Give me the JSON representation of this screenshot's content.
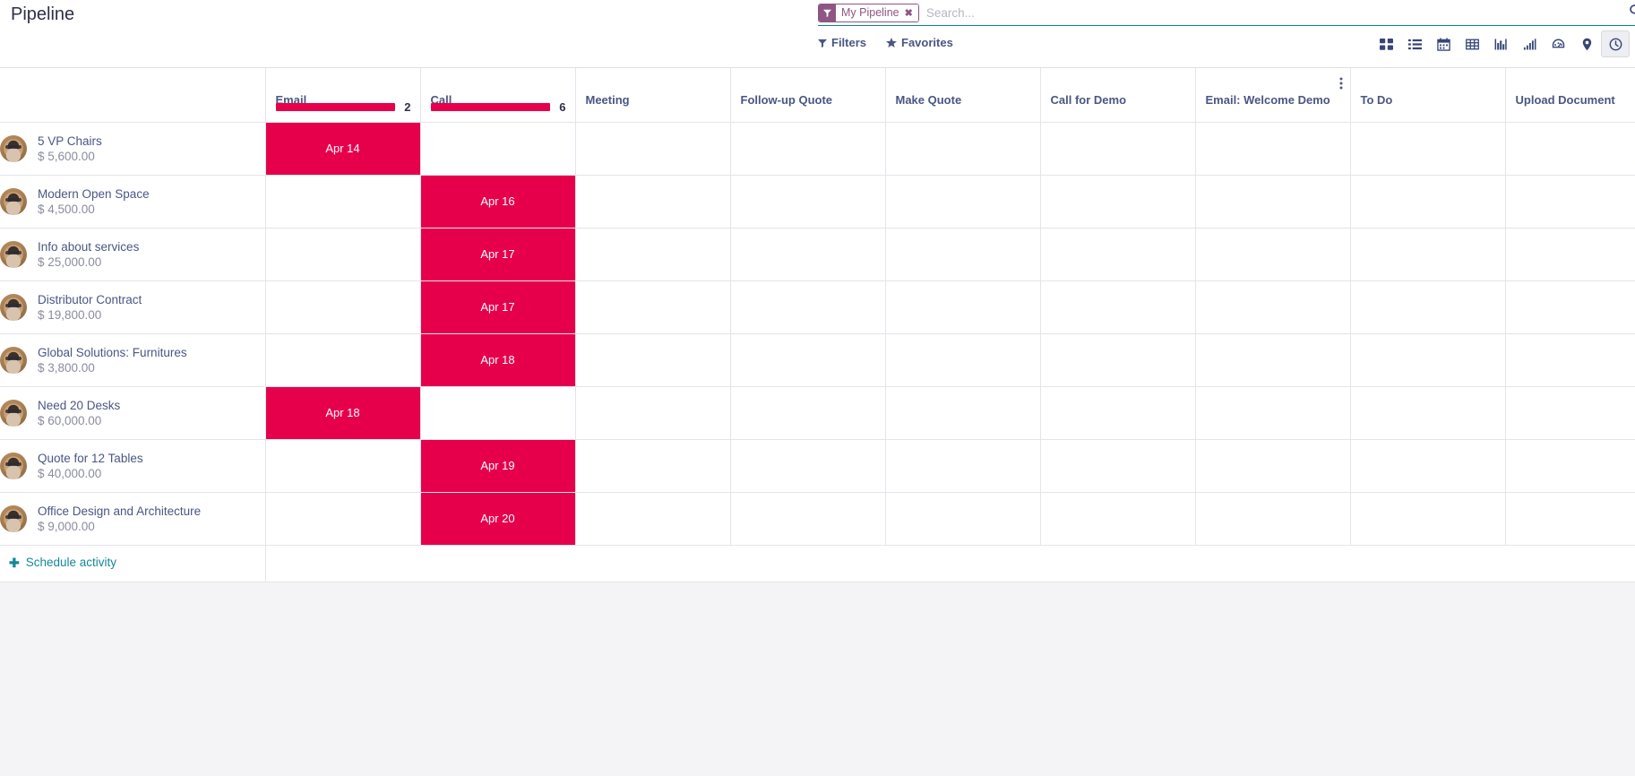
{
  "breadcrumb": {
    "title": "Pipeline"
  },
  "search": {
    "facet": {
      "icon": "filter-icon",
      "label": "My Pipeline",
      "close": "✖"
    },
    "placeholder": "Search...",
    "value": "",
    "toggle_icon": "search-icon"
  },
  "toolbar": {
    "filters_label": "Filters",
    "favorites_label": "Favorites",
    "views": [
      {
        "name": "kanban",
        "title": "Kanban",
        "active": false
      },
      {
        "name": "list",
        "title": "List",
        "active": false
      },
      {
        "name": "calendar",
        "title": "Calendar",
        "active": false
      },
      {
        "name": "pivot",
        "title": "Pivot",
        "active": false
      },
      {
        "name": "graph",
        "title": "Graph",
        "active": false
      },
      {
        "name": "cohort",
        "title": "Cohort",
        "active": false
      },
      {
        "name": "dashboard",
        "title": "Dashboard",
        "active": false
      },
      {
        "name": "map",
        "title": "Map",
        "active": false
      },
      {
        "name": "activity",
        "title": "Activity",
        "active": true
      }
    ]
  },
  "table": {
    "record_column_header": "",
    "columns": [
      {
        "label": "Email",
        "count": "2",
        "progress": 100,
        "has_options": false
      },
      {
        "label": "Call",
        "count": "6",
        "progress": 100,
        "has_options": false
      },
      {
        "label": "Meeting",
        "count": "",
        "progress": 0,
        "has_options": false
      },
      {
        "label": "Follow-up Quote",
        "count": "",
        "progress": 0,
        "has_options": false
      },
      {
        "label": "Make Quote",
        "count": "",
        "progress": 0,
        "has_options": false
      },
      {
        "label": "Call for Demo",
        "count": "",
        "progress": 0,
        "has_options": false
      },
      {
        "label": "Email: Welcome Demo",
        "count": "",
        "progress": 0,
        "has_options": true
      },
      {
        "label": "To Do",
        "count": "",
        "progress": 0,
        "has_options": false
      },
      {
        "label": "Upload Document",
        "count": "",
        "progress": 0,
        "has_options": false
      }
    ],
    "rows": [
      {
        "title": "5 VP Chairs",
        "amount": "$ 5,600.00",
        "cells": [
          "Apr 14",
          "",
          "",
          "",
          "",
          "",
          "",
          "",
          ""
        ]
      },
      {
        "title": "Modern Open Space",
        "amount": "$ 4,500.00",
        "cells": [
          "",
          "Apr 16",
          "",
          "",
          "",
          "",
          "",
          "",
          ""
        ]
      },
      {
        "title": "Info about services",
        "amount": "$ 25,000.00",
        "cells": [
          "",
          "Apr 17",
          "",
          "",
          "",
          "",
          "",
          "",
          ""
        ]
      },
      {
        "title": "Distributor Contract",
        "amount": "$ 19,800.00",
        "cells": [
          "",
          "Apr 17",
          "",
          "",
          "",
          "",
          "",
          "",
          ""
        ]
      },
      {
        "title": "Global Solutions: Furnitures",
        "amount": "$ 3,800.00",
        "cells": [
          "",
          "Apr 18",
          "",
          "",
          "",
          "",
          "",
          "",
          ""
        ]
      },
      {
        "title": "Need 20 Desks",
        "amount": "$ 60,000.00",
        "cells": [
          "Apr 18",
          "",
          "",
          "",
          "",
          "",
          "",
          "",
          ""
        ]
      },
      {
        "title": "Quote for 12 Tables",
        "amount": "$ 40,000.00",
        "cells": [
          "",
          "Apr 19",
          "",
          "",
          "",
          "",
          "",
          "",
          ""
        ]
      },
      {
        "title": "Office Design and Architecture",
        "amount": "$ 9,000.00",
        "cells": [
          "",
          "Apr 20",
          "",
          "",
          "",
          "",
          "",
          "",
          ""
        ]
      }
    ],
    "footer": {
      "schedule_label": "Schedule activity",
      "plus": "✚"
    }
  },
  "colors": {
    "activity_red": "#E6004C",
    "facet_purple": "#8F5584",
    "link_teal": "#14889B",
    "text_navy": "#4A5684"
  }
}
